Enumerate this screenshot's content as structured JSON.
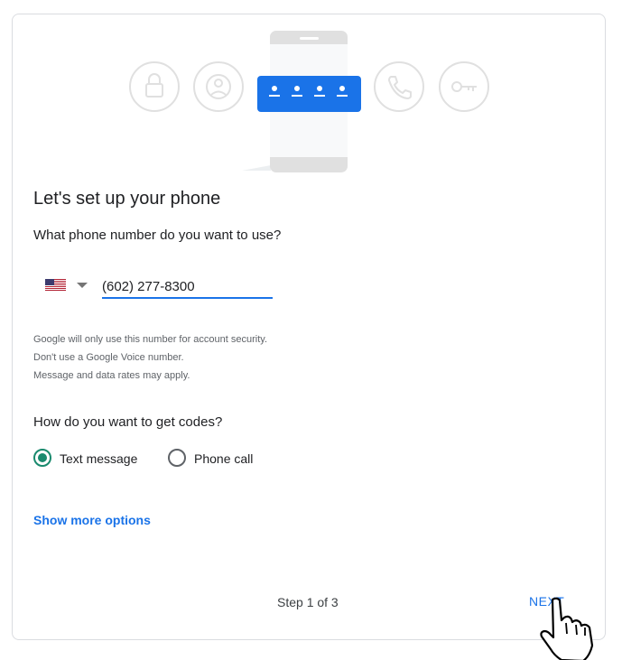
{
  "title": "Let's set up your phone",
  "phone_question": "What phone number do you want to use?",
  "country": {
    "flag_icon": "us-flag-icon"
  },
  "phone_number": "(602) 277-8300",
  "notes": [
    "Google will only use this number for account security.",
    "Don't use a Google Voice number.",
    "Message and data rates may apply."
  ],
  "codes_question": "How do you want to get codes?",
  "code_options": [
    {
      "label": "Text message",
      "selected": true
    },
    {
      "label": "Phone call",
      "selected": false
    }
  ],
  "show_more": "Show more options",
  "step": "Step 1 of 3",
  "next": "NEXT",
  "colors": {
    "accent": "#1a73e8",
    "radio_selected": "#1a8a6e",
    "pin_box": "#1a73e8"
  },
  "illustration_icons": [
    "lock-icon",
    "account-icon",
    "password-dots-icon",
    "phone-icon",
    "key-icon"
  ]
}
